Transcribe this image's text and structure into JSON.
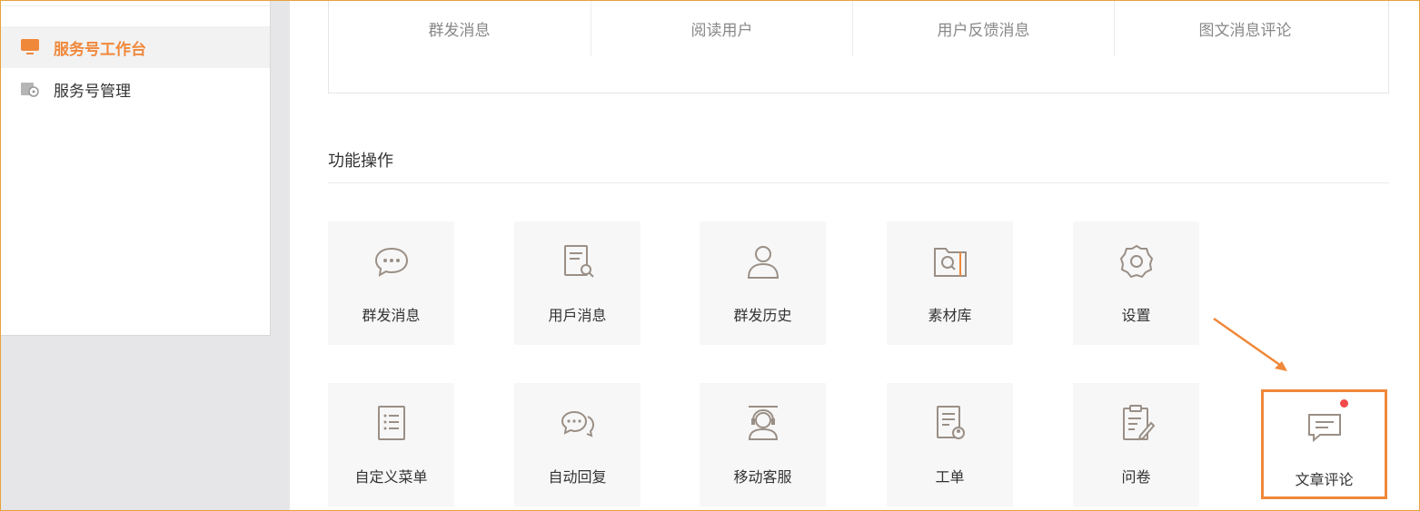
{
  "sidebar": {
    "items": [
      {
        "label": "服务号工作台",
        "icon": "monitor-icon",
        "active": true
      },
      {
        "label": "服务号管理",
        "icon": "gear-icon",
        "active": false
      }
    ]
  },
  "stats": {
    "items": [
      {
        "label": "群发消息"
      },
      {
        "label": "阅读用户"
      },
      {
        "label": "用户反馈消息"
      },
      {
        "label": "图文消息评论"
      }
    ]
  },
  "functions": {
    "title": "功能操作",
    "tiles": [
      {
        "label": "群发消息",
        "icon": "chat-bubble-icon"
      },
      {
        "label": "用戶消息",
        "icon": "document-search-icon"
      },
      {
        "label": "群发历史",
        "icon": "user-icon"
      },
      {
        "label": "素材库",
        "icon": "folder-search-icon"
      },
      {
        "label": "设置",
        "icon": "settings-icon"
      },
      {
        "label": "自定义菜单",
        "icon": "list-icon"
      },
      {
        "label": "自动回复",
        "icon": "chat-bubbles-icon"
      },
      {
        "label": "移动客服",
        "icon": "headset-agent-icon"
      },
      {
        "label": "工单",
        "icon": "ticket-icon"
      },
      {
        "label": "问卷",
        "icon": "survey-icon"
      },
      {
        "label": "文章评论",
        "icon": "comment-icon"
      }
    ]
  },
  "colors": {
    "accent": "#f0883a",
    "notification_dot": "#f24949",
    "icon_stroke": "#9a8f86"
  }
}
